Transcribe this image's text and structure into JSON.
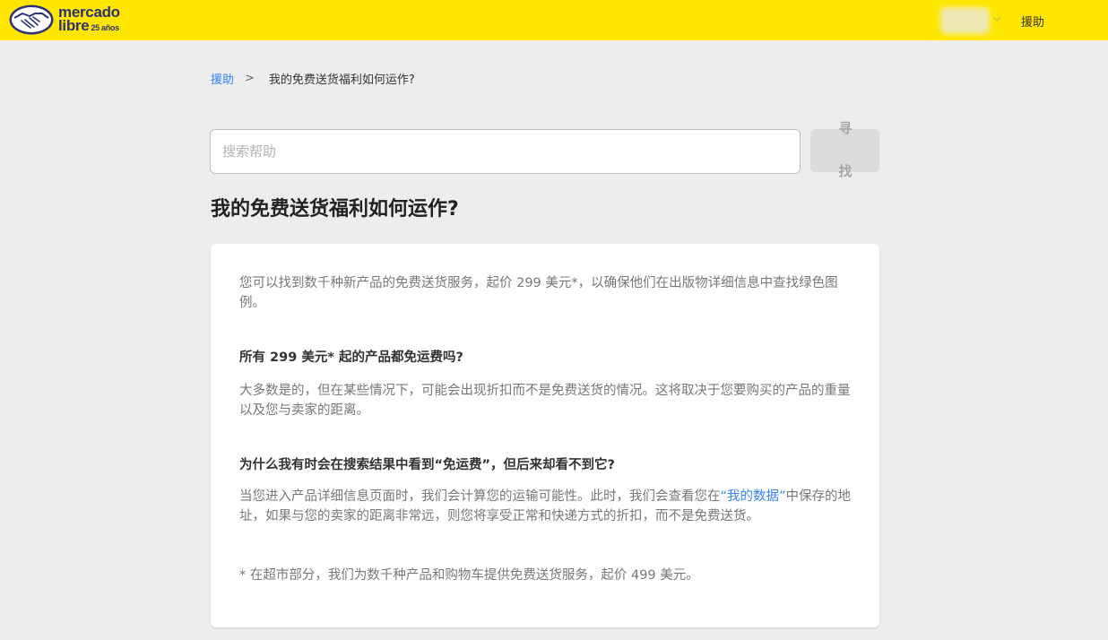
{
  "header": {
    "logo": {
      "line1": "mercado",
      "line2": "libre",
      "anniversary": "25 años",
      "brand_color": "#2d3277"
    },
    "help_label": "援助",
    "bg_color": "#ffe600"
  },
  "breadcrumb": {
    "root": "援助",
    "separator": ">",
    "current": "我的免费送货福利如何运作?"
  },
  "search": {
    "placeholder": "搜索帮助",
    "value": "",
    "button_char1": "寻",
    "button_char2": "找"
  },
  "page_title": "我的免费送货福利如何运作?",
  "article": {
    "intro": "您可以找到数千种新产品的免费送货服务，起价 299 美元*，以确保他们在出版物详细信息中查找绿色图例。",
    "q1": "所有 299 美元* 起的产品都免运费吗?",
    "a1": "大多数是的，但在某些情况下，可能会出现折扣而不是免费送货的情况。这将取决于您要购买的产品的重量以及您与卖家的距离。",
    "q2": "为什么我有时会在搜索结果中看到“免运费”，但后来却看不到它?",
    "a2_before": "当您进入产品详细信息页面时，我们会计算您的运输可能性。此时，我们会查看您在",
    "a2_link": "“我的数据”",
    "a2_after": "中保存的地址，如果与您的卖家的距离非常远，则您将享受正常和快递方式的折扣，而不是免费送货。",
    "footnote": "* 在超市部分，我们为数千种产品和购物车提供免费送货服务，起价 499 美元。"
  },
  "colors": {
    "link": "#3483fa",
    "page_bg": "#ededed"
  }
}
